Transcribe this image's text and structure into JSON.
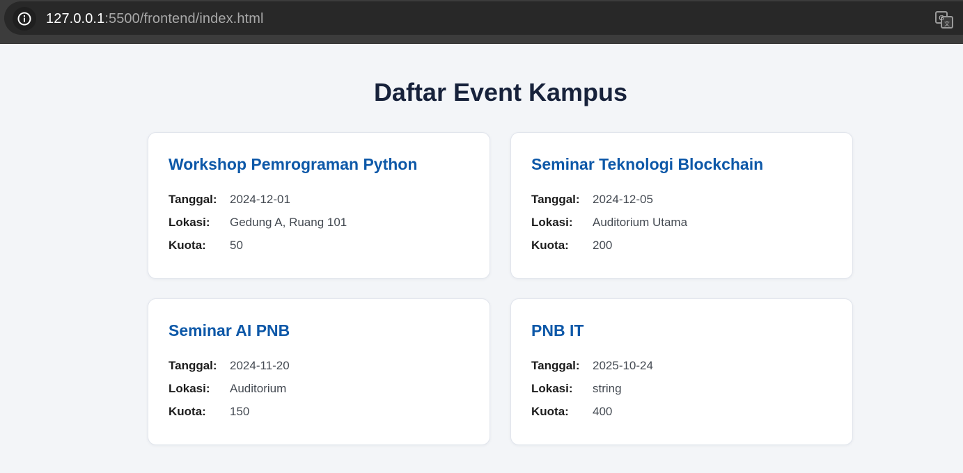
{
  "browser": {
    "url_host": "127.0.0.1",
    "url_rest": ":5500/frontend/index.html",
    "icons": {
      "site_info": "info-icon",
      "translate": "translate-icon"
    }
  },
  "page": {
    "title": "Daftar Event Kampus",
    "colors": {
      "background": "#f3f5f8",
      "title": "#17223b",
      "card_title": "#0d58a8"
    }
  },
  "labels": {
    "date": "Tanggal:",
    "location": "Lokasi:",
    "quota": "Kuota:"
  },
  "events": [
    {
      "name": "Workshop Pemrograman Python",
      "date": "2024-12-01",
      "location": "Gedung A, Ruang 101",
      "quota": "50"
    },
    {
      "name": "Seminar Teknologi Blockchain",
      "date": "2024-12-05",
      "location": "Auditorium Utama",
      "quota": "200"
    },
    {
      "name": "Seminar AI PNB",
      "date": "2024-11-20",
      "location": "Auditorium",
      "quota": "150"
    },
    {
      "name": "PNB IT",
      "date": "2025-10-24",
      "location": "string",
      "quota": "400"
    }
  ]
}
